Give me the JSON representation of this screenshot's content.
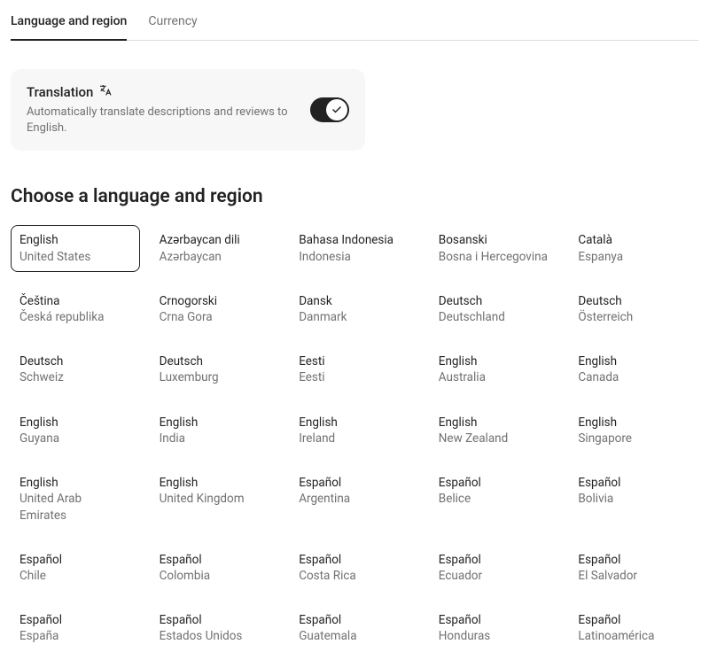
{
  "tabs": [
    {
      "label": "Language and region",
      "active": true
    },
    {
      "label": "Currency",
      "active": false
    }
  ],
  "translation": {
    "title": "Translation",
    "description": "Automatically translate descriptions and reviews to English.",
    "enabled": true
  },
  "heading": "Choose a language and region",
  "languages": [
    {
      "language": "English",
      "region": "United States",
      "selected": true
    },
    {
      "language": "Azərbaycan dili",
      "region": "Azərbaycan"
    },
    {
      "language": "Bahasa Indonesia",
      "region": "Indonesia"
    },
    {
      "language": "Bosanski",
      "region": "Bosna i Hercegovina"
    },
    {
      "language": "Català",
      "region": "Espanya"
    },
    {
      "language": "Čeština",
      "region": "Česká republika"
    },
    {
      "language": "Crnogorski",
      "region": "Crna Gora"
    },
    {
      "language": "Dansk",
      "region": "Danmark"
    },
    {
      "language": "Deutsch",
      "region": "Deutschland"
    },
    {
      "language": "Deutsch",
      "region": "Österreich"
    },
    {
      "language": "Deutsch",
      "region": "Schweiz"
    },
    {
      "language": "Deutsch",
      "region": "Luxemburg"
    },
    {
      "language": "Eesti",
      "region": "Eesti"
    },
    {
      "language": "English",
      "region": "Australia"
    },
    {
      "language": "English",
      "region": "Canada"
    },
    {
      "language": "English",
      "region": "Guyana"
    },
    {
      "language": "English",
      "region": "India"
    },
    {
      "language": "English",
      "region": "Ireland"
    },
    {
      "language": "English",
      "region": "New Zealand"
    },
    {
      "language": "English",
      "region": "Singapore"
    },
    {
      "language": "English",
      "region": "United Arab Emirates"
    },
    {
      "language": "English",
      "region": "United Kingdom"
    },
    {
      "language": "Español",
      "region": "Argentina"
    },
    {
      "language": "Español",
      "region": "Belice"
    },
    {
      "language": "Español",
      "region": "Bolivia"
    },
    {
      "language": "Español",
      "region": "Chile"
    },
    {
      "language": "Español",
      "region": "Colombia"
    },
    {
      "language": "Español",
      "region": "Costa Rica"
    },
    {
      "language": "Español",
      "region": "Ecuador"
    },
    {
      "language": "Español",
      "region": "El Salvador"
    },
    {
      "language": "Español",
      "region": "España"
    },
    {
      "language": "Español",
      "region": "Estados Unidos"
    },
    {
      "language": "Español",
      "region": "Guatemala"
    },
    {
      "language": "Español",
      "region": "Honduras"
    },
    {
      "language": "Español",
      "region": "Latinoamérica"
    }
  ]
}
